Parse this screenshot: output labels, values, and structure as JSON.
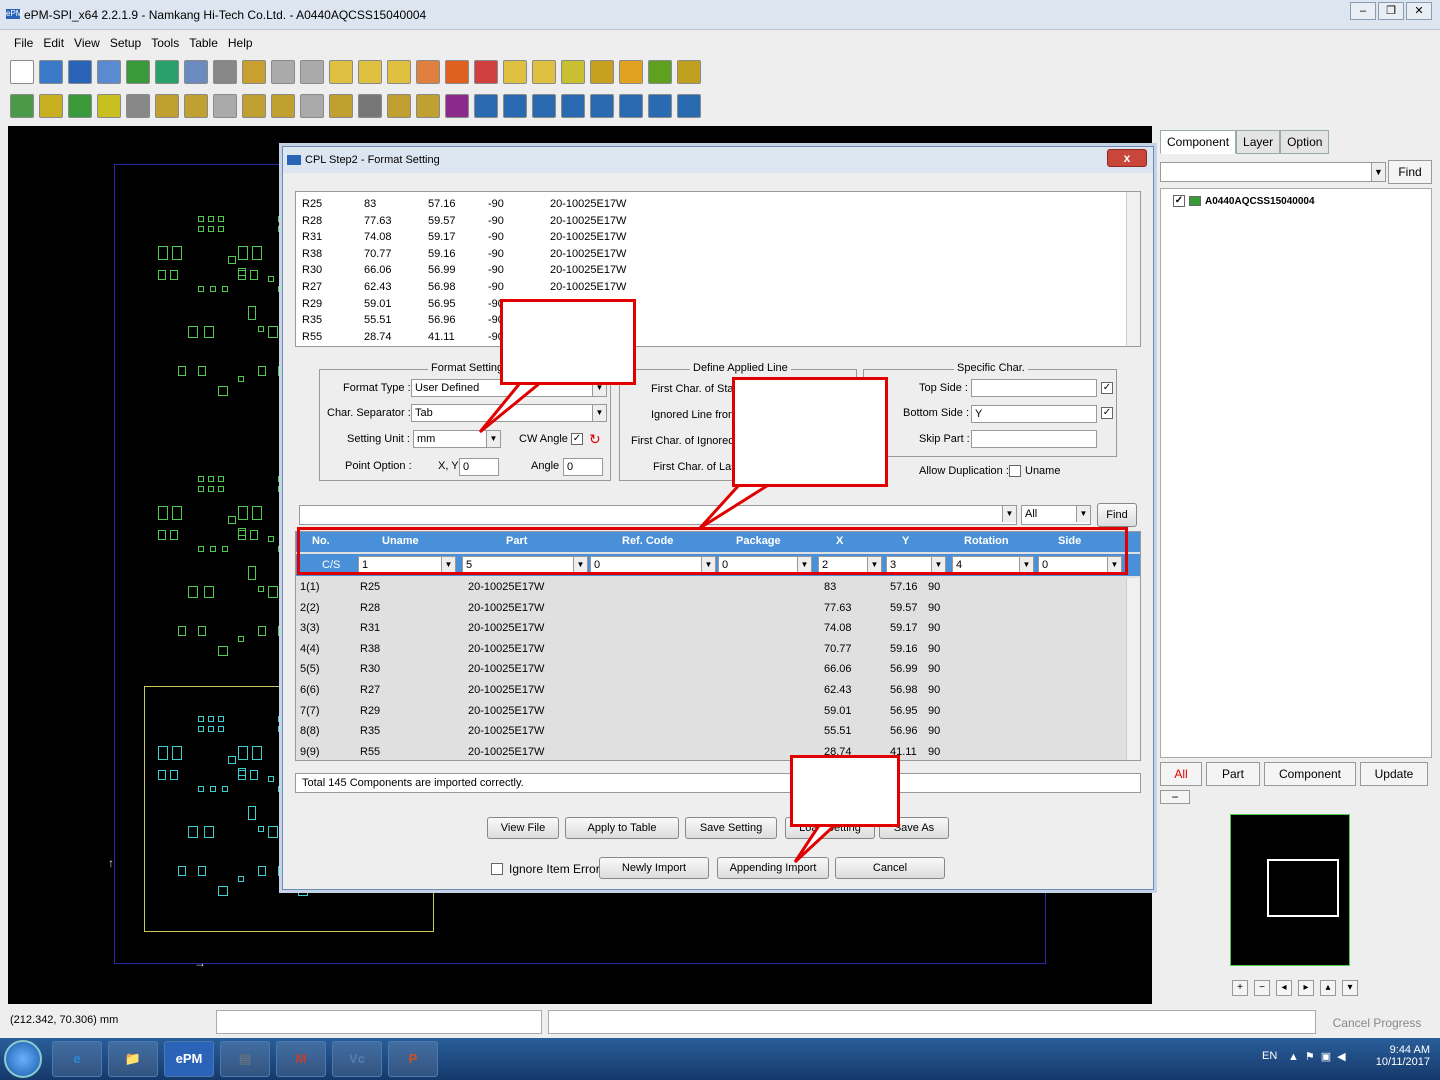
{
  "window": {
    "title": "ePM-SPI_x64 2.2.1.9 - Namkang Hi-Tech Co.Ltd. - A0440AQCSS15040004",
    "icon_label": "ePM"
  },
  "menu": [
    "File",
    "Edit",
    "View",
    "Setup",
    "Tools",
    "Table",
    "Help"
  ],
  "toolbar1": [
    {
      "icon": "new-file-icon",
      "color": "#ffffff"
    },
    {
      "icon": "open-folder-icon",
      "color": "#3a78c8"
    },
    {
      "icon": "save-icon",
      "color": "#2a63b8"
    },
    {
      "icon": "job-icon",
      "color": "#5a8ad0"
    },
    {
      "icon": "txt-icon",
      "color": "#3a9a3a"
    },
    {
      "icon": "import-icon",
      "color": "#2aa06a"
    },
    {
      "icon": "export-icon",
      "color": "#6a8ac0"
    },
    {
      "icon": "grid-icon",
      "color": "#888888"
    },
    {
      "icon": "layout-icon",
      "color": "#c8a030"
    },
    {
      "icon": "undo-icon",
      "color": "#aaaaaa"
    },
    {
      "icon": "redo-icon",
      "color": "#aaaaaa"
    },
    {
      "icon": "zoom-in-icon",
      "color": "#e0c040"
    },
    {
      "icon": "zoom-out-icon",
      "color": "#e0c040"
    },
    {
      "icon": "zoom-area-icon",
      "color": "#e0c040"
    },
    {
      "icon": "zoom-fit-icon",
      "color": "#e08040"
    },
    {
      "icon": "windows-icon",
      "color": "#e06020"
    },
    {
      "icon": "measure-icon",
      "color": "#d04040"
    },
    {
      "icon": "top-icon",
      "color": "#e0c040"
    },
    {
      "icon": "bot-icon",
      "color": "#e0c040"
    },
    {
      "icon": "tool-a-icon",
      "color": "#c8c030"
    },
    {
      "icon": "tool-b-icon",
      "color": "#c8a020"
    },
    {
      "icon": "tool-c-icon",
      "color": "#e0a020"
    },
    {
      "icon": "tool-d-icon",
      "color": "#60a020"
    },
    {
      "icon": "image-icon",
      "color": "#c0a020"
    }
  ],
  "toolbar2": [
    {
      "icon": "pen-icon",
      "color": "#4a9a4a"
    },
    {
      "icon": "scissors-icon",
      "color": "#c8b020"
    },
    {
      "icon": "chip-icon",
      "color": "#3a9a3a"
    },
    {
      "icon": "m-icon",
      "color": "#c8c020"
    },
    {
      "icon": "stack-icon",
      "color": "#888888"
    },
    {
      "icon": "align-icon",
      "color": "#c0a030"
    },
    {
      "icon": "flip-icon",
      "color": "#c0a030"
    },
    {
      "icon": "hand-icon",
      "color": "#aaaaaa"
    },
    {
      "icon": "rotate-icon",
      "color": "#c0a030"
    },
    {
      "icon": "ic-icon",
      "color": "#c0a030"
    },
    {
      "icon": "tiles-icon",
      "color": "#aaaaaa"
    },
    {
      "icon": "merge-icon",
      "color": "#c0a030"
    },
    {
      "icon": "gear-icon",
      "color": "#777777"
    },
    {
      "icon": "ok-icon",
      "color": "#c0a030"
    },
    {
      "icon": "ma-icon",
      "color": "#c0a030"
    },
    {
      "icon": "delete-x-icon",
      "color": "#8a2a8a"
    },
    {
      "icon": "move-icon",
      "color": "#2a6ab0"
    },
    {
      "icon": "link-icon",
      "color": "#2a6ab0"
    },
    {
      "icon": "bars-icon",
      "color": "#2a6ab0"
    },
    {
      "icon": "swap-icon",
      "color": "#2a6ab0"
    },
    {
      "icon": "table-a-icon",
      "color": "#2a6ab0"
    },
    {
      "icon": "table-b-icon",
      "color": "#2a6ab0"
    },
    {
      "icon": "table-c-icon",
      "color": "#2a6ab0"
    },
    {
      "icon": "table-d-icon",
      "color": "#2a6ab0"
    }
  ],
  "right_panel": {
    "tabs": [
      "Component",
      "Layer",
      "Option"
    ],
    "find_label": "Find",
    "tree_root": "A0440AQCSS15040004",
    "buttons": [
      "All",
      "Part",
      "Component",
      "Update"
    ],
    "minus_label": "−",
    "nav_buttons": [
      "+",
      "−",
      "◂",
      "▸",
      "▴",
      "▾"
    ]
  },
  "status": {
    "coord": "(212.342, 70.306) mm",
    "cancel": "Cancel Progress"
  },
  "taskbar": {
    "apps": [
      "e",
      "📁",
      "ePM",
      "▤",
      "M",
      "Vc",
      "P"
    ],
    "lang": "EN",
    "time": "9:44 AM",
    "date": "10/11/2017"
  },
  "dialog": {
    "title": "CPL Step2 - Format Setting",
    "close": "x",
    "file_rows": [
      [
        "R25",
        "83",
        "57.16",
        "-90",
        "20-10025E17W"
      ],
      [
        "R28",
        "77.63",
        "59.57",
        "-90",
        "20-10025E17W"
      ],
      [
        "R31",
        "74.08",
        "59.17",
        "-90",
        "20-10025E17W"
      ],
      [
        "R38",
        "70.77",
        "59.16",
        "-90",
        "20-10025E17W"
      ],
      [
        "R30",
        "66.06",
        "56.99",
        "-90",
        "20-10025E17W"
      ],
      [
        "R27",
        "62.43",
        "56.98",
        "-90",
        "20-10025E17W"
      ],
      [
        "R29",
        "59.01",
        "56.95",
        "-90",
        ""
      ],
      [
        "R35",
        "55.51",
        "56.96",
        "-90",
        ""
      ],
      [
        "R55",
        "28.74",
        "41.11",
        "-90",
        ""
      ]
    ],
    "format_setting": {
      "legend": "Format Setting",
      "format_type_label": "Format Type :",
      "format_type": "User Defined",
      "separator_label": "Char. Separator :",
      "separator": "Tab",
      "unit_label": "Setting Unit :",
      "unit": "mm",
      "cw_label": "CW Angle :",
      "point_label": "Point Option :",
      "xy_label": "X, Y",
      "xy": "0",
      "angle_label": "Angle",
      "angle": "0"
    },
    "define_line": {
      "legend": "Define Applied Line",
      "first_start": "First Char. of Sta",
      "ignored_from": "Ignored Line fron",
      "first_ignored": "First Char. of Ignored",
      "first_last": "First Char. of Las"
    },
    "specific": {
      "legend": "Specific Char.",
      "top_label": "Top Side :",
      "top": "",
      "bottom_label": "Bottom Side :",
      "bottom": "Y",
      "skip_label": "Skip Part :",
      "skip": "",
      "dup_label": "Allow Duplication :",
      "dup_value": "Uname"
    },
    "filter_all": "All",
    "find": "Find",
    "columns": [
      "No.",
      "Uname",
      "Part",
      "Ref. Code",
      "Package",
      "X",
      "Y",
      "Rotation",
      "Side"
    ],
    "cs_label": "C/S",
    "cs_values": [
      "1",
      "5",
      "0",
      "0",
      "2",
      "3",
      "4",
      "0"
    ],
    "rows": [
      [
        "1(1)",
        "R25",
        "20-10025E17W",
        "83",
        "57.16",
        "90"
      ],
      [
        "2(2)",
        "R28",
        "20-10025E17W",
        "77.63",
        "59.57",
        "90"
      ],
      [
        "3(3)",
        "R31",
        "20-10025E17W",
        "74.08",
        "59.17",
        "90"
      ],
      [
        "4(4)",
        "R38",
        "20-10025E17W",
        "70.77",
        "59.16",
        "90"
      ],
      [
        "5(5)",
        "R30",
        "20-10025E17W",
        "66.06",
        "56.99",
        "90"
      ],
      [
        "6(6)",
        "R27",
        "20-10025E17W",
        "62.43",
        "56.98",
        "90"
      ],
      [
        "7(7)",
        "R29",
        "20-10025E17W",
        "59.01",
        "56.95",
        "90"
      ],
      [
        "8(8)",
        "R35",
        "20-10025E17W",
        "55.51",
        "56.96",
        "90"
      ],
      [
        "9(9)",
        "R55",
        "20-10025E17W",
        "28.74",
        "41.11",
        "90"
      ]
    ],
    "message": "Total 145 Components are imported correctly.",
    "buttons_row1": [
      "View File",
      "Apply to Table",
      "Save Setting",
      "Load Setting",
      "Save As"
    ],
    "ignore_error": "Ignore Item Error",
    "buttons_row2": [
      "Newly Import",
      "Appending Import",
      "Cancel"
    ]
  },
  "colors": {
    "accent": "#4a90d9",
    "callout_border": "#e00000",
    "pcb_green": "#4fc94f",
    "pcb_cyan": "#3fd0d0"
  }
}
